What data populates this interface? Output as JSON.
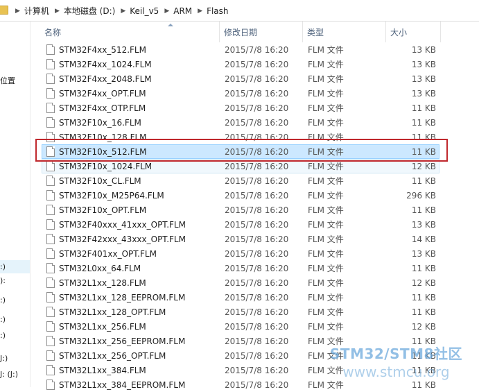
{
  "breadcrumbs": [
    "计算机",
    "本地磁盘 (D:)",
    "Keil_v5",
    "ARM",
    "Flash"
  ],
  "nav": {
    "fragments": [
      {
        "text": "位置",
        "top": 0
      },
      {
        "text": ":)",
        "top": 0
      },
      {
        "text": "):",
        "top": 0
      },
      {
        "text": ":)",
        "top": 0
      },
      {
        "text": ":)",
        "top": 0
      },
      {
        "text": ":)",
        "top": 0
      },
      {
        "text": "J:)",
        "top": 0
      },
      {
        "text": "J: (J:)",
        "top": 0
      }
    ]
  },
  "columns": {
    "name": "名称",
    "date": "修改日期",
    "type": "类型",
    "size": "大小"
  },
  "files": [
    {
      "name": "STM32F4xx_512.FLM",
      "date": "2015/7/8 16:20",
      "type": "FLM 文件",
      "size": "13 KB"
    },
    {
      "name": "STM32F4xx_1024.FLM",
      "date": "2015/7/8 16:20",
      "type": "FLM 文件",
      "size": "13 KB"
    },
    {
      "name": "STM32F4xx_2048.FLM",
      "date": "2015/7/8 16:20",
      "type": "FLM 文件",
      "size": "13 KB"
    },
    {
      "name": "STM32F4xx_OPT.FLM",
      "date": "2015/7/8 16:20",
      "type": "FLM 文件",
      "size": "13 KB"
    },
    {
      "name": "STM32F4xx_OTP.FLM",
      "date": "2015/7/8 16:20",
      "type": "FLM 文件",
      "size": "11 KB"
    },
    {
      "name": "STM32F10x_16.FLM",
      "date": "2015/7/8 16:20",
      "type": "FLM 文件",
      "size": "11 KB"
    },
    {
      "name": "STM32F10x_128.FLM",
      "date": "2015/7/8 16:20",
      "type": "FLM 文件",
      "size": "11 KB"
    },
    {
      "name": "STM32F10x_512.FLM",
      "date": "2015/7/8 16:20",
      "type": "FLM 文件",
      "size": "11 KB"
    },
    {
      "name": "STM32F10x_1024.FLM",
      "date": "2015/7/8 16:20",
      "type": "FLM 文件",
      "size": "12 KB"
    },
    {
      "name": "STM32F10x_CL.FLM",
      "date": "2015/7/8 16:20",
      "type": "FLM 文件",
      "size": "11 KB"
    },
    {
      "name": "STM32F10x_M25P64.FLM",
      "date": "2015/7/8 16:20",
      "type": "FLM 文件",
      "size": "296 KB"
    },
    {
      "name": "STM32F10x_OPT.FLM",
      "date": "2015/7/8 16:20",
      "type": "FLM 文件",
      "size": "11 KB"
    },
    {
      "name": "STM32F40xxx_41xxx_OPT.FLM",
      "date": "2015/7/8 16:20",
      "type": "FLM 文件",
      "size": "13 KB"
    },
    {
      "name": "STM32F42xxx_43xxx_OPT.FLM",
      "date": "2015/7/8 16:20",
      "type": "FLM 文件",
      "size": "14 KB"
    },
    {
      "name": "STM32F401xx_OPT.FLM",
      "date": "2015/7/8 16:20",
      "type": "FLM 文件",
      "size": "13 KB"
    },
    {
      "name": "STM32L0xx_64.FLM",
      "date": "2015/7/8 16:20",
      "type": "FLM 文件",
      "size": "11 KB"
    },
    {
      "name": "STM32L1xx_128.FLM",
      "date": "2015/7/8 16:20",
      "type": "FLM 文件",
      "size": "12 KB"
    },
    {
      "name": "STM32L1xx_128_EEPROM.FLM",
      "date": "2015/7/8 16:20",
      "type": "FLM 文件",
      "size": "11 KB"
    },
    {
      "name": "STM32L1xx_128_OPT.FLM",
      "date": "2015/7/8 16:20",
      "type": "FLM 文件",
      "size": "11 KB"
    },
    {
      "name": "STM32L1xx_256.FLM",
      "date": "2015/7/8 16:20",
      "type": "FLM 文件",
      "size": "12 KB"
    },
    {
      "name": "STM32L1xx_256_EEPROM.FLM",
      "date": "2015/7/8 16:20",
      "type": "FLM 文件",
      "size": "11 KB"
    },
    {
      "name": "STM32L1xx_256_OPT.FLM",
      "date": "2015/7/8 16:20",
      "type": "FLM 文件",
      "size": "11 KB"
    },
    {
      "name": "STM32L1xx_384.FLM",
      "date": "2015/7/8 16:20",
      "type": "FLM 文件",
      "size": "11 KB"
    },
    {
      "name": "STM32L1xx_384_EEPROM.FLM",
      "date": "2015/7/8 16:20",
      "type": "FLM 文件",
      "size": "11 KB"
    }
  ],
  "selected_index": 7,
  "hover_index": 8,
  "highlight_color": "#c0282d",
  "selection_color": "#cce8ff",
  "watermark": {
    "main": "STM32/STM8社区",
    "url": "www.stmcu.org"
  }
}
